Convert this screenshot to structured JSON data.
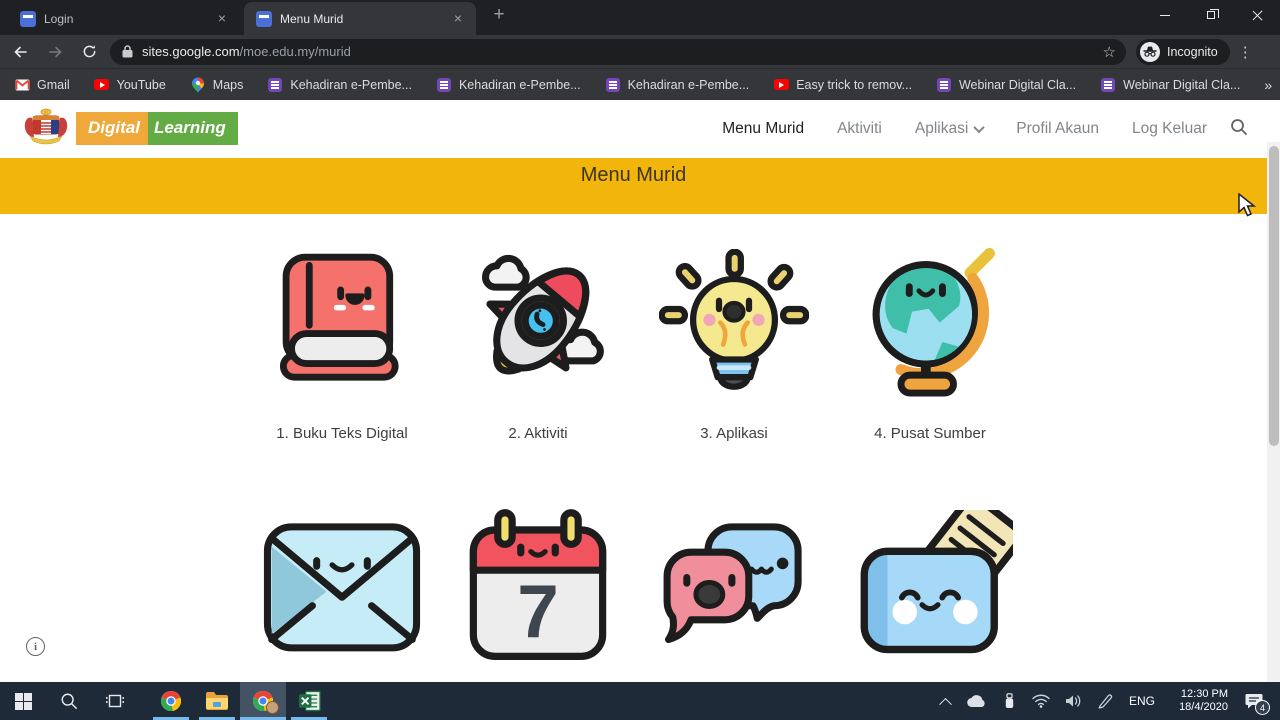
{
  "browser": {
    "tabs": [
      {
        "title": "Login"
      },
      {
        "title": "Menu Murid"
      }
    ],
    "close_glyph": "×",
    "newtab_glyph": "+",
    "address": {
      "domain": "sites.google.com",
      "path": "/moe.edu.my/murid"
    },
    "star_glyph": "☆",
    "incognito_label": "Incognito",
    "menu_glyph": "⋮",
    "bookmarks": [
      {
        "label": "Gmail"
      },
      {
        "label": "YouTube"
      },
      {
        "label": "Maps"
      },
      {
        "label": "Kehadiran e-Pembe..."
      },
      {
        "label": "Kehadiran e-Pembe..."
      },
      {
        "label": "Kehadiran e-Pembe..."
      },
      {
        "label": "Easy trick to remov..."
      },
      {
        "label": "Webinar Digital Cla..."
      },
      {
        "label": "Webinar Digital Cla..."
      }
    ],
    "bookmarks_overflow_glyph": "»"
  },
  "site": {
    "brand": {
      "word1": "Digital",
      "word2": "Learning"
    },
    "nav": [
      {
        "label": "Menu Murid"
      },
      {
        "label": "Aktiviti"
      },
      {
        "label": "Aplikasi"
      },
      {
        "label": "Profil Akaun"
      },
      {
        "label": "Log Keluar"
      }
    ],
    "banner": {
      "title": "Menu Murid",
      "color": "#F2B50C"
    },
    "menu_items": [
      {
        "label": "1. Buku Teks Digital",
        "icon": "book"
      },
      {
        "label": "2. Aktiviti",
        "icon": "rocket"
      },
      {
        "label": "3. Aplikasi",
        "icon": "lightbulb"
      },
      {
        "label": "4. Pusat Sumber",
        "icon": "globe"
      },
      {
        "label": "",
        "icon": "envelope"
      },
      {
        "label": "",
        "icon": "calendar"
      },
      {
        "label": "",
        "icon": "chat"
      },
      {
        "label": "",
        "icon": "wallet"
      }
    ],
    "calendar_day": "7",
    "info_glyph": "i"
  },
  "taskbar": {
    "language": "ENG",
    "time": "12:30 PM",
    "date": "18/4/2020",
    "notification_count": "4"
  }
}
